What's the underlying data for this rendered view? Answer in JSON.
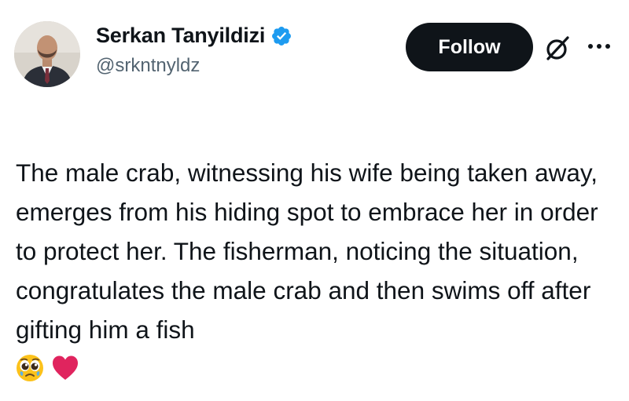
{
  "author": {
    "display_name": "Serkan Tanyildizi",
    "handle": "@srkntnyldz",
    "verified": true
  },
  "actions": {
    "follow_label": "Follow",
    "icons": [
      "grok-icon",
      "more-icon"
    ]
  },
  "tweet": {
    "text": "The male crab, witnessing his wife being taken away, emerges from his hiding spot to embrace her in order to protect her. The fisherman, noticing the situation, congratulates the male crab and then swims off after gifting him a fish",
    "emojis": [
      "pleading-face-emoji",
      "red-heart-emoji"
    ]
  },
  "colors": {
    "text": "#0f1419",
    "secondary": "#536471",
    "verified_blue": "#1d9bf0",
    "button_bg": "#0f1419",
    "heart": "#e0245e"
  }
}
